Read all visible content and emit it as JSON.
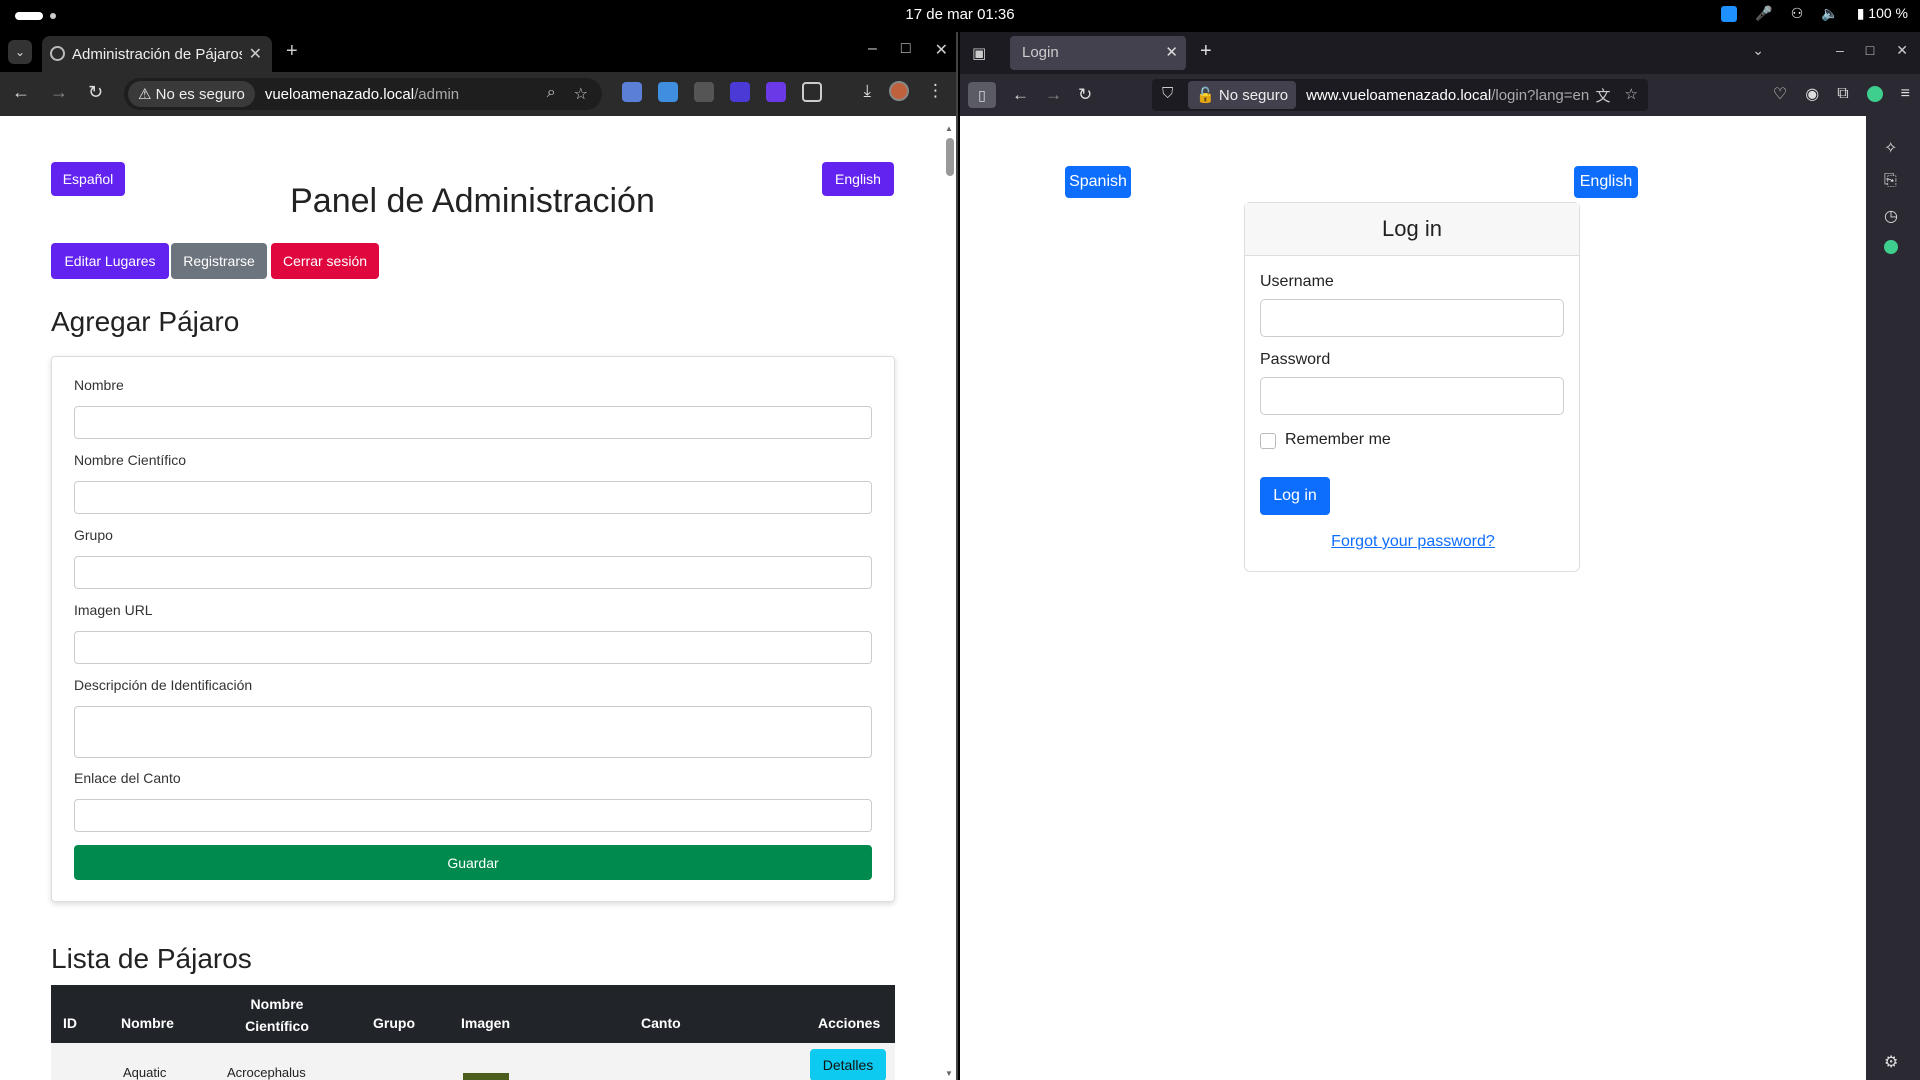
{
  "topbar": {
    "clock": "17 de mar  01:36",
    "battery": "100 %"
  },
  "chrome": {
    "tab_title": "Administración de Pájaros",
    "security": "No es seguro",
    "url_host": "vueloamenazado.local",
    "url_path": "/admin"
  },
  "admin": {
    "lang_es": "Español",
    "lang_en": "English",
    "title": "Panel de Administración",
    "btn_edit_places": "Editar Lugares",
    "btn_register": "Registrarse",
    "btn_logout": "Cerrar sesión",
    "add_heading": "Agregar Pájaro",
    "fields": {
      "name": "Nombre",
      "sci_name": "Nombre Científico",
      "group": "Grupo",
      "image_url": "Imagen URL",
      "id_desc": "Descripción de Identificación",
      "song_link": "Enlace del Canto"
    },
    "save": "Guardar",
    "list_heading": "Lista de Pájaros",
    "table": {
      "headers": [
        "ID",
        "Nombre",
        "Nombre Científico",
        "Grupo",
        "Imagen",
        "Canto",
        "Acciones"
      ],
      "row1": {
        "name": "Aquatic",
        "sci": "Acrocephalus",
        "action": "Detalles"
      }
    }
  },
  "firefox": {
    "tab_title": "Login",
    "security": "No seguro",
    "url_host": "www.vueloamenazado.local",
    "url_path": "/login?lang=en"
  },
  "login": {
    "lang_es": "Spanish",
    "lang_en": "English",
    "title": "Log in",
    "username_label": "Username",
    "password_label": "Password",
    "remember": "Remember me",
    "submit": "Log in",
    "forgot": "Forgot your password?"
  },
  "colors": {
    "purple": "#6222f0",
    "blue": "#0d6efd",
    "red": "#e0073f",
    "green": "#008a4d"
  }
}
